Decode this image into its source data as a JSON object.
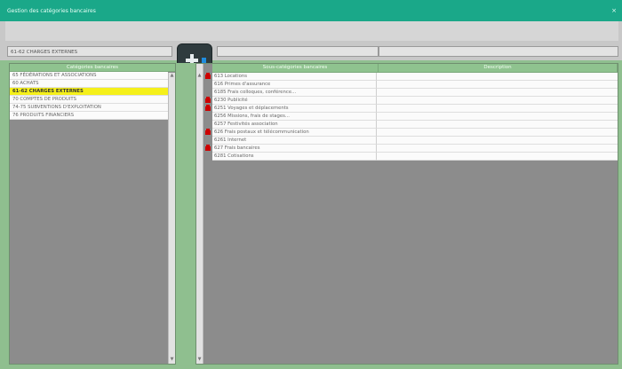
{
  "window": {
    "title": "Gestion des catégories bancaires",
    "close_glyph": "×"
  },
  "toolbar": {
    "path_value": "61-62 CHARGES EXTERNES",
    "save_icon": "add-save-icon"
  },
  "left_panel": {
    "header": "Catégories bancaires",
    "items": [
      {
        "label": "65 FÉDÉRATIONS ET ASSOCIATIONS",
        "selected": false
      },
      {
        "label": "60 ACHATS",
        "selected": false
      },
      {
        "label": "61-62 CHARGES EXTERNES",
        "selected": true
      },
      {
        "label": "70 COMPTES DE PRODUITS",
        "selected": false
      },
      {
        "label": "74-75 SUBVENTIONS D'EXPLOITATION",
        "selected": false
      },
      {
        "label": "76 PRODUITS FINANCIERS",
        "selected": false
      }
    ]
  },
  "right_panel": {
    "headers": [
      "Sous-catégories bancaires",
      "Description"
    ],
    "rows": [
      {
        "name": "613 Locations",
        "flag": true
      },
      {
        "name": "616 Primes d'assurance",
        "flag": false
      },
      {
        "name": "6185 Frais colloques, conférence...",
        "flag": false
      },
      {
        "name": "6230 Publicité",
        "flag": true
      },
      {
        "name": "6251 Voyages et déplacements",
        "flag": true
      },
      {
        "name": "6256 Missions, frais de stages...",
        "flag": false
      },
      {
        "name": "6257 Festivités association",
        "flag": false
      },
      {
        "name": "626 Frais postaux et télécommunication",
        "flag": true
      },
      {
        "name": "6261 Internet",
        "flag": false
      },
      {
        "name": "627 Frais bancaires",
        "flag": true
      },
      {
        "name": "6281 Cotisations",
        "flag": false
      }
    ]
  },
  "colors": {
    "titlebar": "#1aa889",
    "header_green": "#8fc38f",
    "selected": "#f5f01a",
    "flag": "#cc0000"
  }
}
